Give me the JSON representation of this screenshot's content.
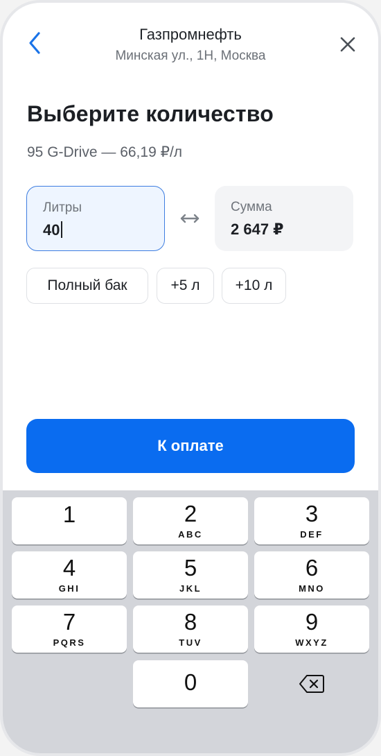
{
  "header": {
    "title": "Газпромнефть",
    "address": "Минская ул., 1Н, Москва"
  },
  "main": {
    "heading": "Выберите количество",
    "fuel_price": "95 G-Drive — 66,19 ₽/л",
    "liters": {
      "label": "Литры",
      "value": "40"
    },
    "sum": {
      "label": "Сумма",
      "value": "2 647 ₽"
    },
    "chips": {
      "full": "Полный бак",
      "plus5": "+5 л",
      "plus10": "+10 л"
    },
    "pay_button": "К оплате"
  },
  "keypad": {
    "keys": [
      {
        "digit": "1",
        "letters": ""
      },
      {
        "digit": "2",
        "letters": "ABC"
      },
      {
        "digit": "3",
        "letters": "DEF"
      },
      {
        "digit": "4",
        "letters": "GHI"
      },
      {
        "digit": "5",
        "letters": "JKL"
      },
      {
        "digit": "6",
        "letters": "MNO"
      },
      {
        "digit": "7",
        "letters": "PQRS"
      },
      {
        "digit": "8",
        "letters": "TUV"
      },
      {
        "digit": "9",
        "letters": "WXYZ"
      },
      {
        "digit": "0",
        "letters": ""
      }
    ]
  },
  "colors": {
    "accent": "#0a6cf0",
    "active_field_border": "#3d7de0",
    "active_field_bg": "#eef5ff",
    "keyboard_bg": "#d3d5da"
  },
  "icons": {
    "back": "chevron-left-icon",
    "close": "close-icon",
    "swap": "swap-horizontal-icon",
    "backspace": "backspace-icon"
  }
}
